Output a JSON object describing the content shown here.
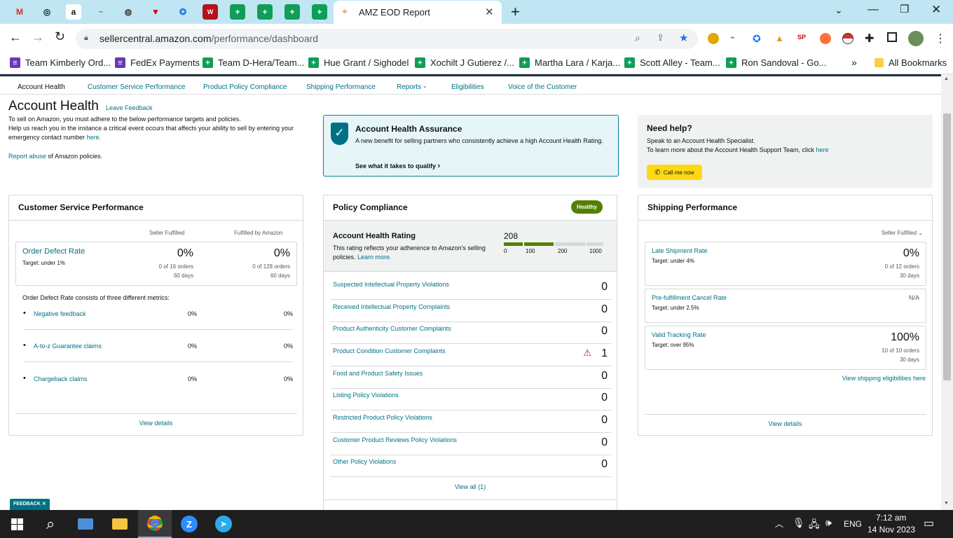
{
  "browser": {
    "active_tab_title": "AMZ EOD Report",
    "url_host": "sellercentral.amazon.com",
    "url_path": "/performance/dashboard",
    "bookmarks": [
      "Team Kimberly Ord...",
      "FedEx Payments",
      "Team D-Hera/Team...",
      "Hue Grant / Sighodel",
      "Xochilt J Gutierez /...",
      "Martha Lara / Karja...",
      "Scott Alley - Team...",
      "Ron Sandoval - Go..."
    ],
    "all_bookmarks": "All Bookmarks"
  },
  "nav": [
    "Account Health",
    "Customer Service Performance",
    "Product Policy Compliance",
    "Shipping Performance",
    "Reports",
    "Eligibilities",
    "Voice of the Customer"
  ],
  "header": {
    "title": "Account Health",
    "leave_feedback": "Leave Feedback",
    "intro1": "To sell on Amazon, you must adhere to the below performance targets and policies.",
    "intro2_pre": "Help us reach you in the instance a critical event occurs that affects your ability to sell by entering your emergency contact number ",
    "intro2_link": "here.",
    "report_link": "Report abuse",
    "report_rest": " of Amazon policies."
  },
  "aha": {
    "title": "Account Health Assurance",
    "text": "A new benefit for selling partners who consistently achieve a high Account Health Rating.",
    "link": "See what it takes to qualify"
  },
  "help": {
    "title": "Need help?",
    "line1": "Speak to an Account Health Specialist.",
    "line2": "To learn more about the Account Health Support Team, click ",
    "here": "here",
    "button": "Call me now"
  },
  "csp": {
    "title": "Customer Service Performance",
    "col1": "Seller Fulfilled",
    "col2": "Fulfilled by Amazon",
    "odr_label": "Order Defect Rate",
    "odr_target": "Target: under 1%",
    "sf_value": "0%",
    "sf_orders": "0 of 16 orders",
    "sf_days": "60 days",
    "fba_value": "0%",
    "fba_orders": "0 of 128 orders",
    "fba_days": "60 days",
    "consists": "Order Defect Rate consists of three different metrics:",
    "metrics": [
      {
        "label": "Negative feedback",
        "sf": "0%",
        "fba": "0%"
      },
      {
        "label": "A-to-z Guarantee claims",
        "sf": "0%",
        "fba": "0%"
      },
      {
        "label": "Chargeback claims",
        "sf": "0%",
        "fba": "0%"
      }
    ],
    "view_details": "View details"
  },
  "policy": {
    "title": "Policy Compliance",
    "badge": "Healthy",
    "ahr_title": "Account Health Rating",
    "ahr_text": "This rating reflects your adherence to Amazon's selling policies. ",
    "learn_more": "Learn more.",
    "score": "208",
    "score_value": 208,
    "ticks": [
      "0",
      "100",
      "200",
      "1000"
    ],
    "rows": [
      {
        "label": "Suspected Intellectual Property Violations",
        "value": "0"
      },
      {
        "label": "Received Intellectual Property Complaints",
        "value": "0"
      },
      {
        "label": "Product Authenticity Customer Complaints",
        "value": "0"
      },
      {
        "label": "Product Condition Customer Complaints",
        "value": "1"
      },
      {
        "label": "Food and Product Safety Issues",
        "value": "0"
      },
      {
        "label": "Listing Policy Violations",
        "value": "0"
      },
      {
        "label": "Restricted Product Policy Violations",
        "value": "0"
      },
      {
        "label": "Customer Product Reviews Policy Violations",
        "value": "0"
      },
      {
        "label": "Other Policy Violations",
        "value": "0"
      }
    ],
    "view_all": "View all (1)",
    "colors": {
      "healthy": "#538000",
      "bar_fill": "#538000",
      "warning": "#cc0c39"
    }
  },
  "shipping": {
    "title": "Shipping Performance",
    "filter": "Seller Fulfilled",
    "metrics": [
      {
        "label": "Late Shipment Rate",
        "target": "Target: under 4%",
        "value": "0%",
        "orders": "0 of 12 orders",
        "days": "30 days"
      },
      {
        "label": "Pre-fulfillment Cancel Rate",
        "target": "Target: under 2.5%",
        "value": "N/A",
        "orders": "",
        "days": ""
      },
      {
        "label": "Valid Tracking Rate",
        "target": "Target: over 95%",
        "value": "100%",
        "orders": "10 of 10 orders",
        "days": "30 days"
      }
    ],
    "eligibilities_link": "View shipping eligibilities here",
    "view_details": "View details"
  },
  "feedback_tab": "FEEDBACK",
  "taskbar": {
    "lang": "ENG",
    "time": "7:12 am",
    "date": "14 Nov 2023"
  }
}
